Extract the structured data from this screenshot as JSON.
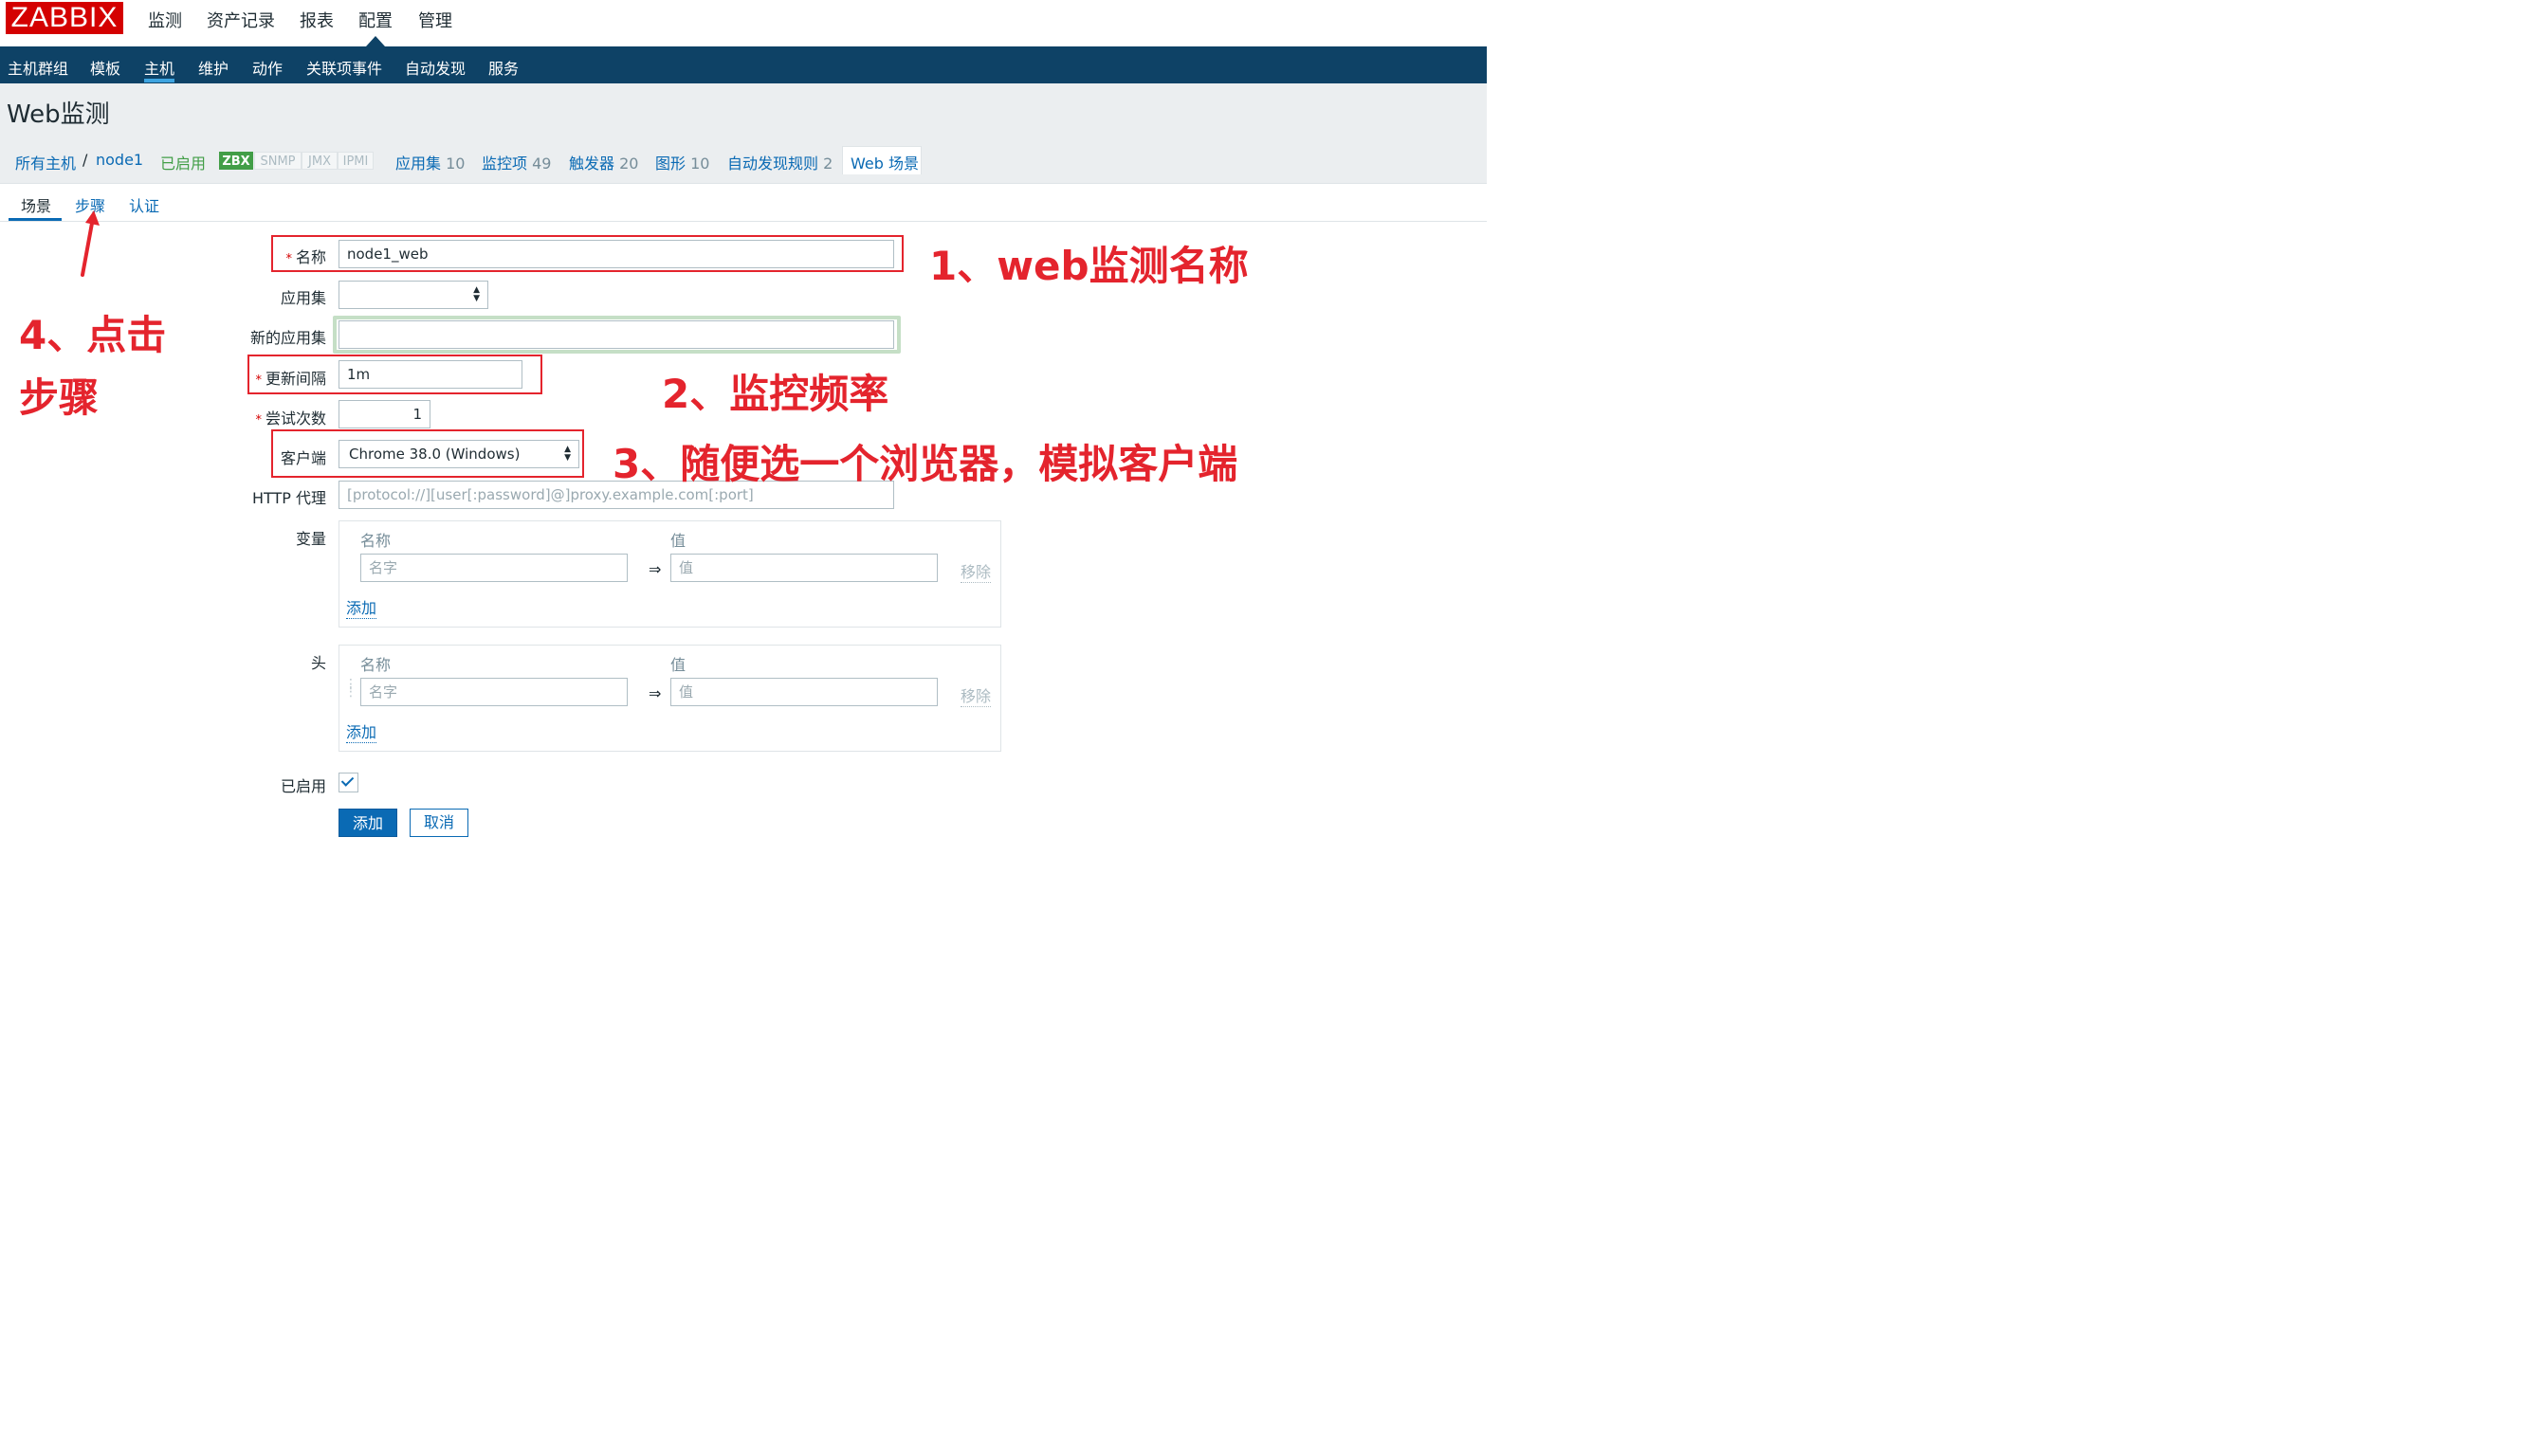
{
  "header": {
    "logo": "ZABBIX",
    "main_menu": [
      "监测",
      "资产记录",
      "报表",
      "配置",
      "管理"
    ],
    "active_main": "配置",
    "sub_menu": [
      "主机群组",
      "模板",
      "主机",
      "维护",
      "动作",
      "关联项事件",
      "自动发现",
      "服务"
    ],
    "active_sub": "主机"
  },
  "page": {
    "title": "Web监测"
  },
  "host_nav": {
    "all_hosts": "所有主机",
    "separator": "/",
    "host": "node1",
    "status": "已启用",
    "availability": [
      "ZBX",
      "SNMP",
      "JMX",
      "IPMI"
    ],
    "links": [
      {
        "label": "应用集",
        "count": "10"
      },
      {
        "label": "监控项",
        "count": "49"
      },
      {
        "label": "触发器",
        "count": "20"
      },
      {
        "label": "图形",
        "count": "10"
      },
      {
        "label": "自动发现规则",
        "count": "2"
      }
    ],
    "active_tab": "Web 场景"
  },
  "form_tabs": [
    "场景",
    "步骤",
    "认证"
  ],
  "form": {
    "name": {
      "label": "名称",
      "value": "node1_web"
    },
    "application": {
      "label": "应用集",
      "value": ""
    },
    "new_application": {
      "label": "新的应用集",
      "value": ""
    },
    "update_interval": {
      "label": "更新间隔",
      "value": "1m"
    },
    "attempts": {
      "label": "尝试次数",
      "value": "1"
    },
    "agent": {
      "label": "客户端",
      "value": "Chrome 38.0 (Windows)"
    },
    "http_proxy": {
      "label": "HTTP 代理",
      "placeholder": "[protocol://][user[:password]@]proxy.example.com[:port]"
    },
    "variables": {
      "label": "变量",
      "col_name": "名称",
      "col_value": "值",
      "name_placeholder": "名字",
      "value_placeholder": "值",
      "arrow": "⇒",
      "remove": "移除",
      "add": "添加"
    },
    "headers": {
      "label": "头",
      "col_name": "名称",
      "col_value": "值",
      "name_placeholder": "名字",
      "value_placeholder": "值",
      "arrow": "⇒",
      "remove": "移除",
      "add": "添加"
    },
    "enabled": {
      "label": "已启用",
      "checked": true
    },
    "buttons": {
      "add": "添加",
      "cancel": "取消"
    }
  },
  "annotations": {
    "a1": "1、web监测名称",
    "a2": "2、监控频率",
    "a3": "3、随便选一个浏览器，模拟客户端",
    "a4_line1": "4、点击",
    "a4_line2": "步骤"
  },
  "colors": {
    "logo_red": "#d40000",
    "nav_blue": "#0e4266",
    "link_blue": "#0a6ab4",
    "enabled_green": "#429e47",
    "annotation_red": "#e4242d"
  }
}
